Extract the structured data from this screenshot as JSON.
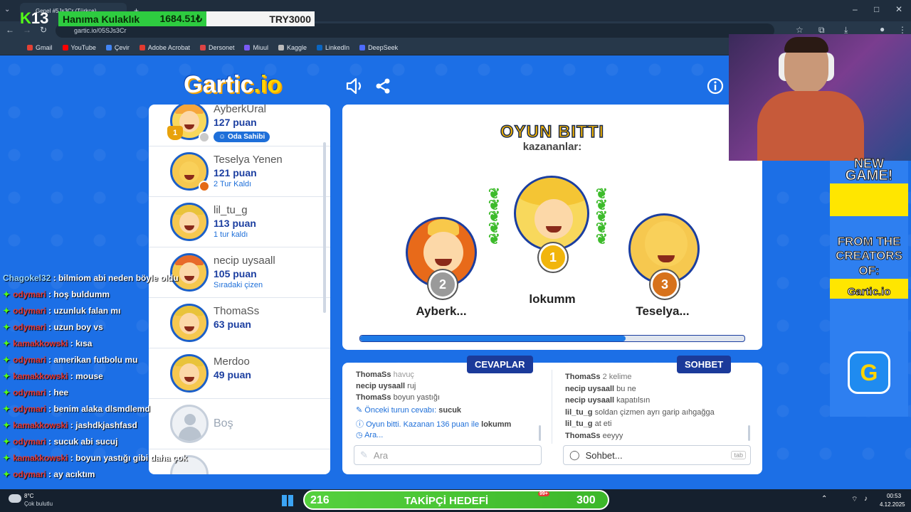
{
  "stream_banner": {
    "brand_digits": "13",
    "item": "Hanıma Kulaklık",
    "amount": "1684.51₺",
    "goal": "TRY3000"
  },
  "browser": {
    "tab_title": "Genel #5Js3Cr (Türkçe)",
    "url": "gartic.io/05SJs3Cr",
    "bookmarks": [
      "Gmail",
      "YouTube",
      "Çevir",
      "Adobe Acrobat",
      "Dersonet",
      "Miuul",
      "Kaggle",
      "LinkedIn",
      "DeepSeek"
    ]
  },
  "game": {
    "logo_main": "Gartic",
    "logo_io": ".io",
    "players": [
      {
        "name": "AyberkUral",
        "points": "127 puan",
        "badge": "Oda Sahibi",
        "hair": "#f6a63a",
        "ring": "#f8d85c"
      },
      {
        "name": "Teselya Yenen",
        "points": "121 puan",
        "note": "2 Tur Kaldı",
        "hair": "#f6c84f",
        "ring": "#f6c84f"
      },
      {
        "name": "lil_tu_g",
        "points": "113 puan",
        "note": "1 tur kaldı",
        "hair": "#e9c33a",
        "ring": "#f6c84f"
      },
      {
        "name": "necip uysaall",
        "points": "105 puan",
        "note": "Sıradaki çizen",
        "hair": "#e86a2a",
        "ring": "#f6c84f"
      },
      {
        "name": "ThomaSs",
        "points": "63 puan",
        "hair": "#e9c33a",
        "ring": "#f6c84f"
      },
      {
        "name": "Merdoo",
        "points": "49 puan",
        "hair": "#e9c33a",
        "ring": "#f6c84f"
      },
      {
        "name": "Boş"
      }
    ],
    "end": {
      "title": "OYUN BITTI",
      "subtitle": "kazananlar:",
      "winners": [
        {
          "place": "1",
          "name": "lokumm",
          "medal_color": "#f1b50c"
        },
        {
          "place": "2",
          "name": "Ayberk...",
          "medal_color": "#9a9a9a"
        },
        {
          "place": "3",
          "name": "Teselya...",
          "medal_color": "#d7721c"
        }
      ],
      "progress": 0.69
    },
    "answers_label": "CEVAPLAR",
    "chat_label": "SOHBET",
    "answers_log": [
      {
        "user": "ThomaSs",
        "text": "havuç"
      },
      {
        "user": "necip uysaall",
        "text": "ruj"
      },
      {
        "user": "ThomaSs",
        "text": "boyun yastığı"
      }
    ],
    "prev_answer_prefix": "Önceki turun cevabı:",
    "prev_answer": "sucuk",
    "winner_msg_prefix": "Oyun bitti. Kazanan 136 puan ile",
    "winner_msg_name": "lokumm",
    "searching": "Ara...",
    "answer_placeholder": "Ara",
    "chat_log": [
      {
        "user": "ThomaSs",
        "text": "2 kelime"
      },
      {
        "user": "necip uysaall",
        "text": "bu ne"
      },
      {
        "user": "necip uysaall",
        "text": "kapatılsın"
      },
      {
        "user": "lil_tu_g",
        "text": "soldan çizmen ayrı garip aıhgağga"
      },
      {
        "user": "lil_tu_g",
        "text": "at eti"
      },
      {
        "user": "ThomaSs",
        "text": "eeyyy"
      }
    ],
    "chat_placeholder": "Sohbet...",
    "chat_key_hint": "tab"
  },
  "stream_chat": [
    {
      "user": "Chagokel32",
      "text": ": bilmiom abi neden böyle oldu",
      "first": true
    },
    {
      "user": "odymari",
      "text": ": hoş buldumm"
    },
    {
      "user": "odymari",
      "text": ": uzunluk falan mı"
    },
    {
      "user": "odymari",
      "text": ": uzun boy vs"
    },
    {
      "user": "kamakkowski",
      "text": ": kısa"
    },
    {
      "user": "odymari",
      "text": ": amerikan futbolu mu"
    },
    {
      "user": "kamakkowski",
      "text": ": mouse"
    },
    {
      "user": "odymari",
      "text": ": hee"
    },
    {
      "user": "odymari",
      "text": ": benim alaka dlsmdlemd"
    },
    {
      "user": "kamakkowski",
      "text": ": jashdkjashfasd"
    },
    {
      "user": "odymari",
      "text": ": sucuk abi sucuj"
    },
    {
      "user": "kamakkowski",
      "text": ": boyun yastığı gibi daha çok"
    },
    {
      "user": "odymari",
      "text": ": ay acıktım"
    }
  ],
  "ad": {
    "line1": "NEW",
    "line2": "GAME!",
    "line3": "FROM THE",
    "line4": "CREATORS",
    "line5": "OF:",
    "logo": "Gartic.io",
    "icon": "G"
  },
  "taskbar": {
    "weather_temp": "8°C",
    "weather_desc": "Çok bulutlu",
    "follower_count": "216",
    "follower_label": "TAKİPÇİ HEDEFİ",
    "follower_goal": "300",
    "badge": "99+",
    "time": "00:53",
    "date": "4.12.2025"
  }
}
